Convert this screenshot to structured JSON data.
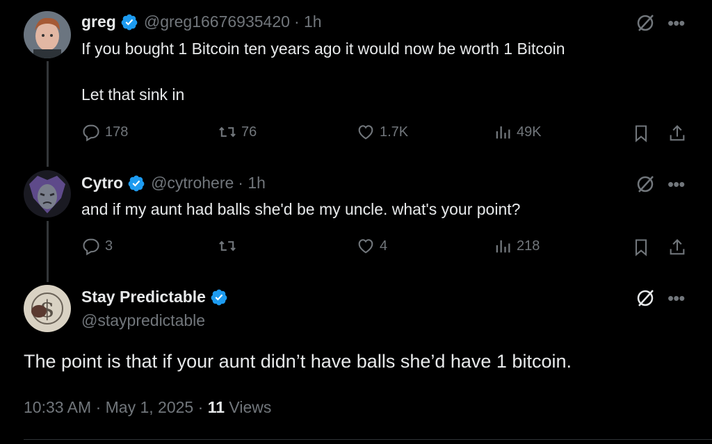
{
  "tweet1": {
    "name": "greg",
    "handle": "@greg16676935420",
    "time": "· 1h",
    "text_line1": "If you bought 1 Bitcoin ten years ago it would now be worth 1 Bitcoin",
    "text_line2": "Let that sink in",
    "replies": "178",
    "reposts": "76",
    "likes": "1.7K",
    "views": "49K"
  },
  "tweet2": {
    "name": "Cytro",
    "handle": "@cytrohere",
    "time": "· 1h",
    "text": "and if my aunt had balls she'd be my uncle. what's your point?",
    "replies": "3",
    "reposts": "",
    "likes": "4",
    "views": "218"
  },
  "main": {
    "name": "Stay Predictable",
    "handle": "@staypredictable",
    "text": "The point is that if your aunt didn’t have balls she’d have 1 bitcoin.",
    "time": "10:33 AM",
    "date": "May 1, 2025",
    "views_count": "11",
    "views_label": "Views"
  },
  "colors": {
    "background": "#000000",
    "text": "#e7e9ea",
    "muted": "#71767b",
    "verified": "#1d9bf0"
  },
  "icons": [
    "verified-badge-icon",
    "reply-icon",
    "repost-icon",
    "like-icon",
    "views-icon",
    "bookmark-icon",
    "share-icon",
    "grok-icon",
    "more-icon"
  ]
}
